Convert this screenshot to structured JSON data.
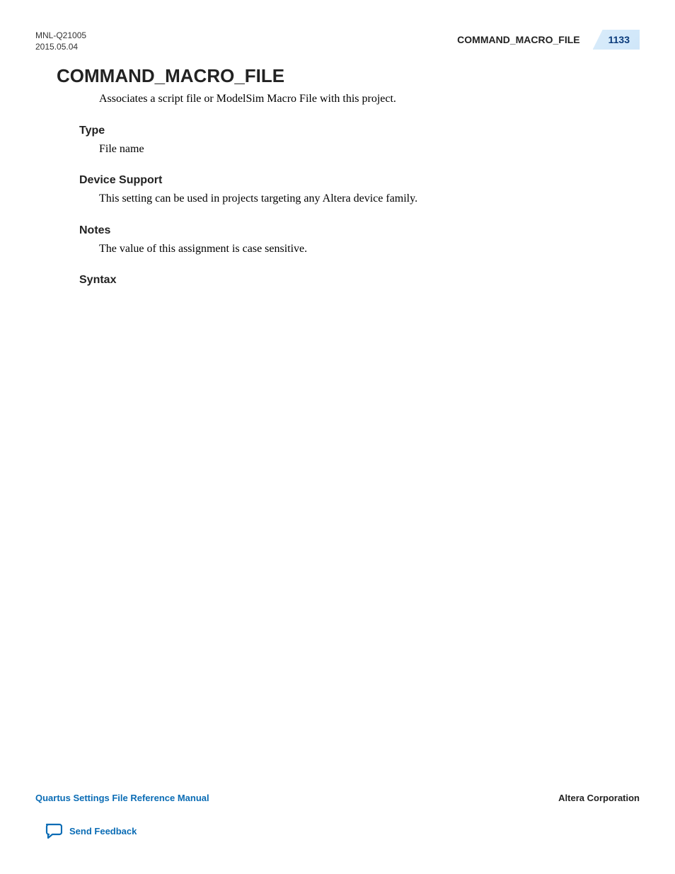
{
  "header": {
    "doc_id": "MNL-Q21005",
    "date": "2015.05.04",
    "command_label": "COMMAND_MACRO_FILE",
    "page_number": "1133"
  },
  "main": {
    "title": "COMMAND_MACRO_FILE",
    "description": "Associates a script file or ModelSim Macro File with this project.",
    "sections": [
      {
        "heading": "Type",
        "body": "File name"
      },
      {
        "heading": "Device Support",
        "body": "This setting can be used in projects targeting any Altera device family."
      },
      {
        "heading": "Notes",
        "body": "The value of this assignment is case sensitive."
      },
      {
        "heading": "Syntax",
        "body": ""
      }
    ]
  },
  "footer": {
    "manual_title": "Quartus Settings File Reference Manual",
    "corporation": "Altera Corporation",
    "feedback_label": "Send Feedback"
  }
}
